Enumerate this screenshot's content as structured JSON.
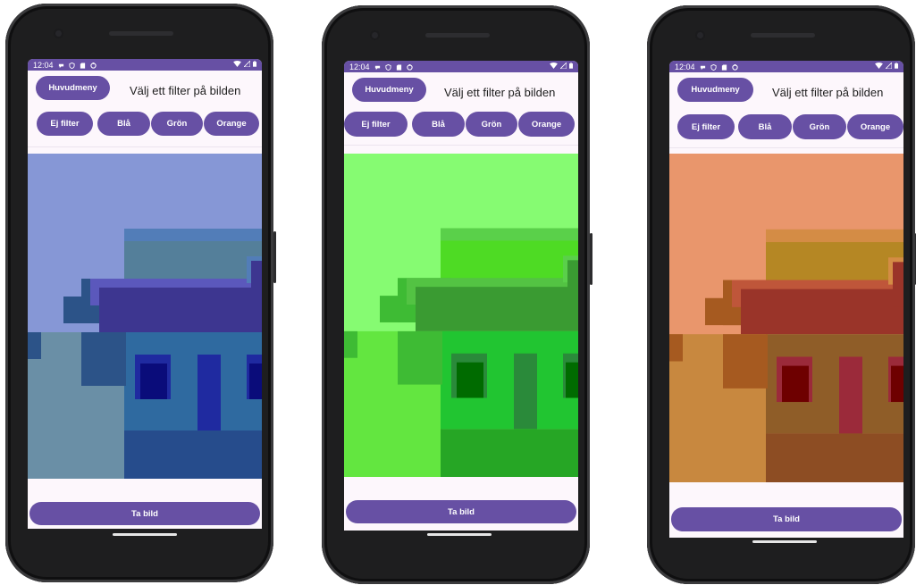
{
  "status": {
    "time": "12:04"
  },
  "app": {
    "menu_label": "Huvudmeny",
    "title": "Välj ett filter på bilden",
    "filters": [
      "Ej filter",
      "Blå",
      "Grön",
      "Orange"
    ],
    "capture_label": "Ta bild"
  },
  "colors": {
    "accent": "#6750a4"
  },
  "phones": [
    {
      "active_filter": "Blå",
      "palette": {
        "sky": "#8697d6",
        "ground": "#6a8fa6",
        "wall_top": "#547f9a",
        "wall": "#2f6aa0",
        "roof": "#3d3690",
        "roof_edge": "#5b58bc",
        "window": "#1f2aa0",
        "window_dark": "#0a0c7a",
        "base": "#264c8c",
        "shadow": "#2c5388",
        "edge": "#527db8"
      }
    },
    {
      "active_filter": "Grön",
      "palette": {
        "sky": "#86fb72",
        "ground": "#63e640",
        "wall_top": "#4edb24",
        "wall": "#21c531",
        "roof": "#3a9b32",
        "roof_edge": "#53c343",
        "window": "#2a8a3a",
        "window_dark": "#006b00",
        "base": "#26a625",
        "shadow": "#3ebb34",
        "edge": "#5ad04a"
      }
    },
    {
      "active_filter": "Orange",
      "palette": {
        "sky": "#e9966c",
        "ground": "#c8883f",
        "wall_top": "#b58724",
        "wall": "#8f5d28",
        "roof": "#9a3429",
        "roof_edge": "#bf563a",
        "window": "#9b2a3a",
        "window_dark": "#6e0000",
        "base": "#8d4d23",
        "shadow": "#a65a20",
        "edge": "#d48c45"
      }
    }
  ]
}
